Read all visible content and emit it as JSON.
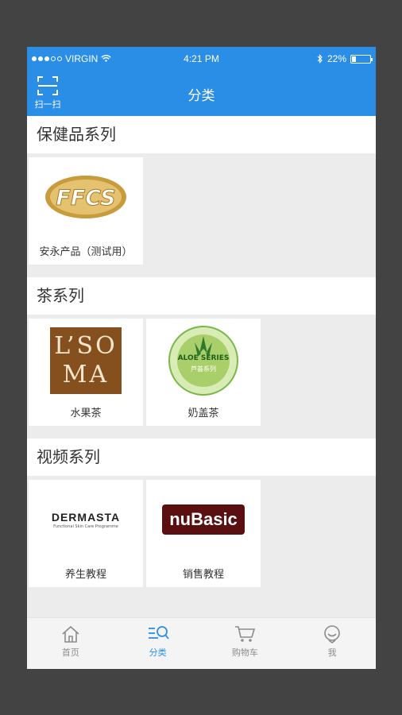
{
  "status_bar": {
    "carrier": "VIRGIN",
    "time": "4:21 PM",
    "battery_percent": "22%",
    "battery_level": 0.22
  },
  "nav": {
    "scan_label": "扫一扫",
    "title": "分类"
  },
  "sections": [
    {
      "title": "保健品系列",
      "items": [
        {
          "name": "安永产品（测试用）",
          "logo_text": "FFCS"
        }
      ]
    },
    {
      "title": "茶系列",
      "items": [
        {
          "name": "水果茶",
          "logo_line1": "L’SO",
          "logo_line2": "MA"
        },
        {
          "name": "奶盖茶",
          "logo_text": "ALOE SERIES",
          "logo_subtext": "芦荟系列"
        }
      ]
    },
    {
      "title": "视频系列",
      "items": [
        {
          "name": "养生教程",
          "logo_text": "DERMASTA",
          "logo_subtext": "Functional Skin Care Programme"
        },
        {
          "name": "销售教程",
          "logo_text": "nuBasic"
        }
      ]
    }
  ],
  "tabs": [
    {
      "label": "首页",
      "icon": "home-icon"
    },
    {
      "label": "分类",
      "icon": "category-icon",
      "active": true
    },
    {
      "label": "购物车",
      "icon": "cart-icon"
    },
    {
      "label": "我",
      "icon": "profile-icon"
    }
  ],
  "colors": {
    "primary": "#2a8de6",
    "background": "#ececec",
    "frame": "#434343"
  }
}
